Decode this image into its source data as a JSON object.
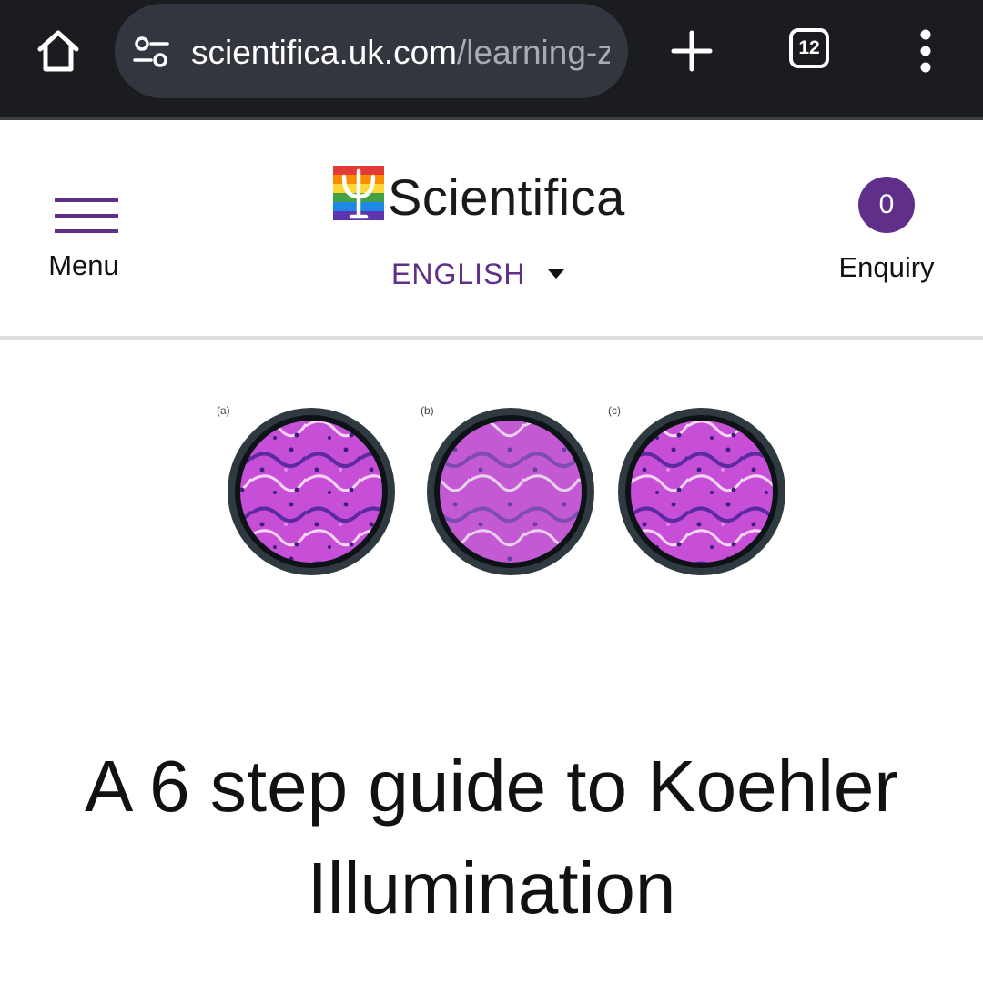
{
  "browser": {
    "url_host": "scientifica.uk.com",
    "url_path": "/learning-zo",
    "tab_count": "12",
    "icons": [
      "home-icon",
      "site-settings-icon",
      "new-tab-icon",
      "tab-switcher-icon",
      "more-menu-icon"
    ]
  },
  "header": {
    "menu_label": "Menu",
    "logo_text": "Scientifica",
    "language": "ENGLISH",
    "enquiry_count": "0",
    "enquiry_label": "Enquiry",
    "accent_color": "#5f2f8a"
  },
  "hero": {
    "panel_labels": [
      "(a)",
      "(b)",
      "(c)"
    ]
  },
  "article": {
    "title": "A 6 step guide to Koehler Illumination"
  }
}
